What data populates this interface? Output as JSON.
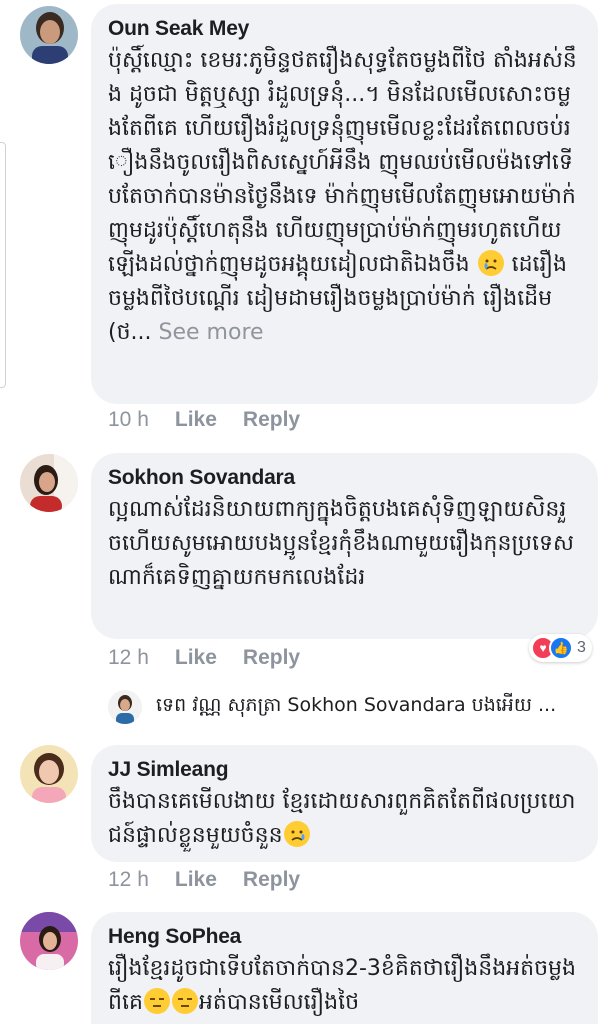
{
  "comments": [
    {
      "name": "Oun Seak Mey",
      "text": "ប៉ុស្តិ៍ឈ្មោះ ខេមរៈភូមិន្ទថតរឿងសុទ្ធតែចម្លងពីថៃ តាំងអស់នឹង ដូចជា មិត្តឬស្សា រំដួលទ្រនុំ...។ មិនដែលមើលសោះចម្លងតែពីគេ ហើយរឿងរំដួលទ្រនុំញុមមើលខ្លះដែរតែពេលចប់រឿងនឹងចូលរឿងពិសស្នេហ៍អីនឹង ញុមឈប់មើលម៉ងទៅទើបតែចាក់បានម៉ានថ្ងៃនឹងទេ ម៉ាក់ញុមមើលតែញុមអោយម៉ាក់ញុមដូរប៉ុស្តិ៍ហេតុនឹង ហើយញុមប្រាប់ម៉ាក់ញុមរហូតហើយឡើងដល់ថ្នាក់ញុមដូចអង្គុយដៀលជាតិឯងចឹង",
      "text_tail": " ដេរឿងចម្លងពីថៃបណ្តើរ ដៀមដាមរឿងចម្លងប្រាប់ម៉ាក់ រឿងដើម(ថ...",
      "see_more": "See more",
      "time": "10 h",
      "like": "Like",
      "reply": "Reply"
    },
    {
      "name": "Sokhon Sovandara",
      "text": "ល្អណាស់ដែរនិយាយពាក្យក្នុងចិត្តបងគេសុំទិញឡាយសិនរួចហើយសូមអោយបងប្អូនខ្មែរកុំខឹងណាមួយរឿងកុនប្រទេសណាក៏គេទិញគ្នាយកមកលេងដែរ",
      "time": "12 h",
      "like": "Like",
      "reply": "Reply",
      "reaction_count": "3"
    },
    {
      "name": "JJ Simleang",
      "text": "ចឹងបានគេមើលងាយ ខ្មែរដោយសារពួកគិតតែពីផលប្រយោជន៍ផ្ទាល់ខ្លួនមួយចំនួន",
      "time": "12 h",
      "like": "Like",
      "reply": "Reply"
    },
    {
      "name": "Heng SoPhea",
      "text": "រឿងខ្មែរដូចជាទើបតែចាក់បាន2-3ខំគិតថារឿងនឹងអត់ចម្លងពីគេ",
      "text_tail": "អត់បានមើលរឿងថៃ"
    }
  ],
  "reply_preview": {
    "text": "ទេព វណ្ណ សុភត្រា Sokhon Sovandara បងអើយ ..."
  },
  "colors": {
    "bubble": "#f0f2f5",
    "meta": "#8d949e",
    "love": "#f33e58",
    "like": "#1877f2"
  }
}
